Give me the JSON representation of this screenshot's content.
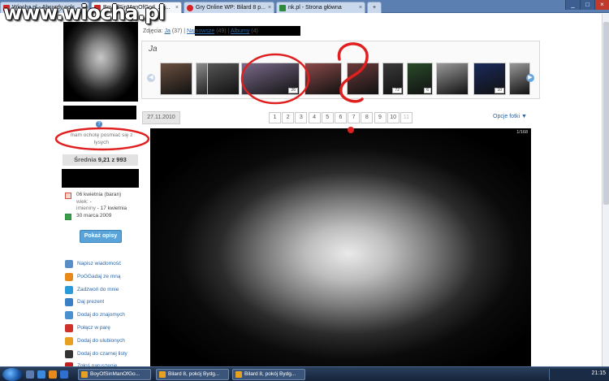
{
  "browser": {
    "tabs": [
      {
        "title": "Wiocha.pl - Absurdy pols...",
        "favicon_color": "#cc2a2a",
        "active": false
      },
      {
        "title": "BoyOfSinManOfGod, zdj...",
        "favicon_color": "#cc2a2a",
        "active": true
      },
      {
        "title": "Gry Online WP: Bilard 8 p...",
        "favicon_color": "#d82020",
        "active": false
      },
      {
        "title": "nk.pl - Strona główna",
        "favicon_color": "#2e8b3e",
        "active": false
      }
    ],
    "window_buttons": [
      "_",
      "□",
      "×"
    ]
  },
  "watermark": "www.wiocha.pl",
  "photo_nav": {
    "prefix": "Zdjęcia:",
    "ja_label": "Ja",
    "ja_count": "(37)",
    "najnowsze_label": "Najnowsze",
    "najnowsze_count": "(49)",
    "albumy_label": "Albumy",
    "albumy_count": "(4)"
  },
  "profile": {
    "help_glyph": "?",
    "status_text": "mam ochotę posmiać się z łysych",
    "average_label": "Średnia",
    "average_value": "9,21 z 993",
    "birthday": "06 kwietnia (baran)",
    "age_label": "wiek:",
    "age_value": "-",
    "nameday_label": "imieniny",
    "nameday_value": "- 17 kwietnia",
    "joined": "30 marca 2009",
    "describe_button": "Pokaż opisy"
  },
  "actions": [
    {
      "label": "Napisz wiadomość",
      "icon": "envelope-icon",
      "color": "#5a8ec8"
    },
    {
      "label": "PoGGadaj ze mną",
      "icon": "gg-flower-icon",
      "color": "#e88a1a"
    },
    {
      "label": "Zadzwoń do mnie",
      "icon": "skype-icon",
      "color": "#2a9ad8"
    },
    {
      "label": "Daj prezent",
      "icon": "gift-icon",
      "color": "#3b7fc4"
    },
    {
      "label": "Dodaj do znajomych",
      "icon": "add-friend-icon",
      "color": "#4a90d0"
    },
    {
      "label": "Połącz w parę",
      "icon": "heart-icon",
      "color": "#d0302a"
    },
    {
      "label": "Dodaj do ulubionych",
      "icon": "star-icon",
      "color": "#e8a020"
    },
    {
      "label": "Dodaj do czarnej listy",
      "icon": "blacklist-icon",
      "color": "#333333"
    },
    {
      "label": "Zgłoś naruszenie",
      "icon": "report-icon",
      "color": "#c02020"
    }
  ],
  "album": {
    "title": "Ja",
    "thumbnails": [
      {
        "count": "",
        "tone": "#6a5040"
      },
      {
        "count": "",
        "tone": "#8a8a8a"
      },
      {
        "count": "",
        "tone": "#555555"
      },
      {
        "count": "26",
        "tone": "#7a6a8a"
      },
      {
        "count": "",
        "tone": "#8a4a4a"
      },
      {
        "count": "",
        "tone": "#6a3a3a"
      },
      {
        "count": "72",
        "tone": "#3a3a3a"
      },
      {
        "count": "6",
        "tone": "#2a4a2a"
      },
      {
        "count": "",
        "tone": "#9a9a9a"
      },
      {
        "count": "10",
        "tone": "#1a2a5a"
      },
      {
        "count": "",
        "tone": "#999999"
      }
    ]
  },
  "photo": {
    "date": "27.11.2010",
    "pages": [
      "1",
      "2",
      "3",
      "4",
      "5",
      "6",
      "7",
      "8",
      "9",
      "10",
      "11"
    ],
    "options_label": "Opcje fotki ▼",
    "image_badge": "1/168"
  },
  "taskbar": {
    "items": [
      {
        "label": "BoyOfSinManOfGo...",
        "favicon_color": "#e8a020"
      },
      {
        "label": "Bilard 8, pokój Bydg...",
        "favicon_color": "#e8a020"
      },
      {
        "label": "Bilard 8, pokój Bydg...",
        "favicon_color": "#e8a020"
      }
    ],
    "clock": "21:15"
  },
  "annotation_colors": {
    "marker": "#e02020"
  }
}
